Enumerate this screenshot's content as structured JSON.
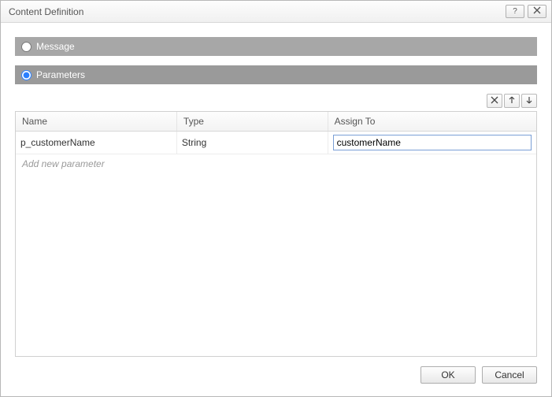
{
  "titlebar": {
    "title": "Content Definition"
  },
  "options": {
    "message_label": "Message",
    "parameters_label": "Parameters",
    "selected": "parameters"
  },
  "table": {
    "headers": {
      "name": "Name",
      "type": "Type",
      "assign": "Assign To"
    },
    "rows": [
      {
        "name": "p_customerName",
        "type": "String",
        "assign": "customerName"
      }
    ],
    "placeholder": "Add new parameter"
  },
  "buttons": {
    "ok": "OK",
    "cancel": "Cancel"
  }
}
